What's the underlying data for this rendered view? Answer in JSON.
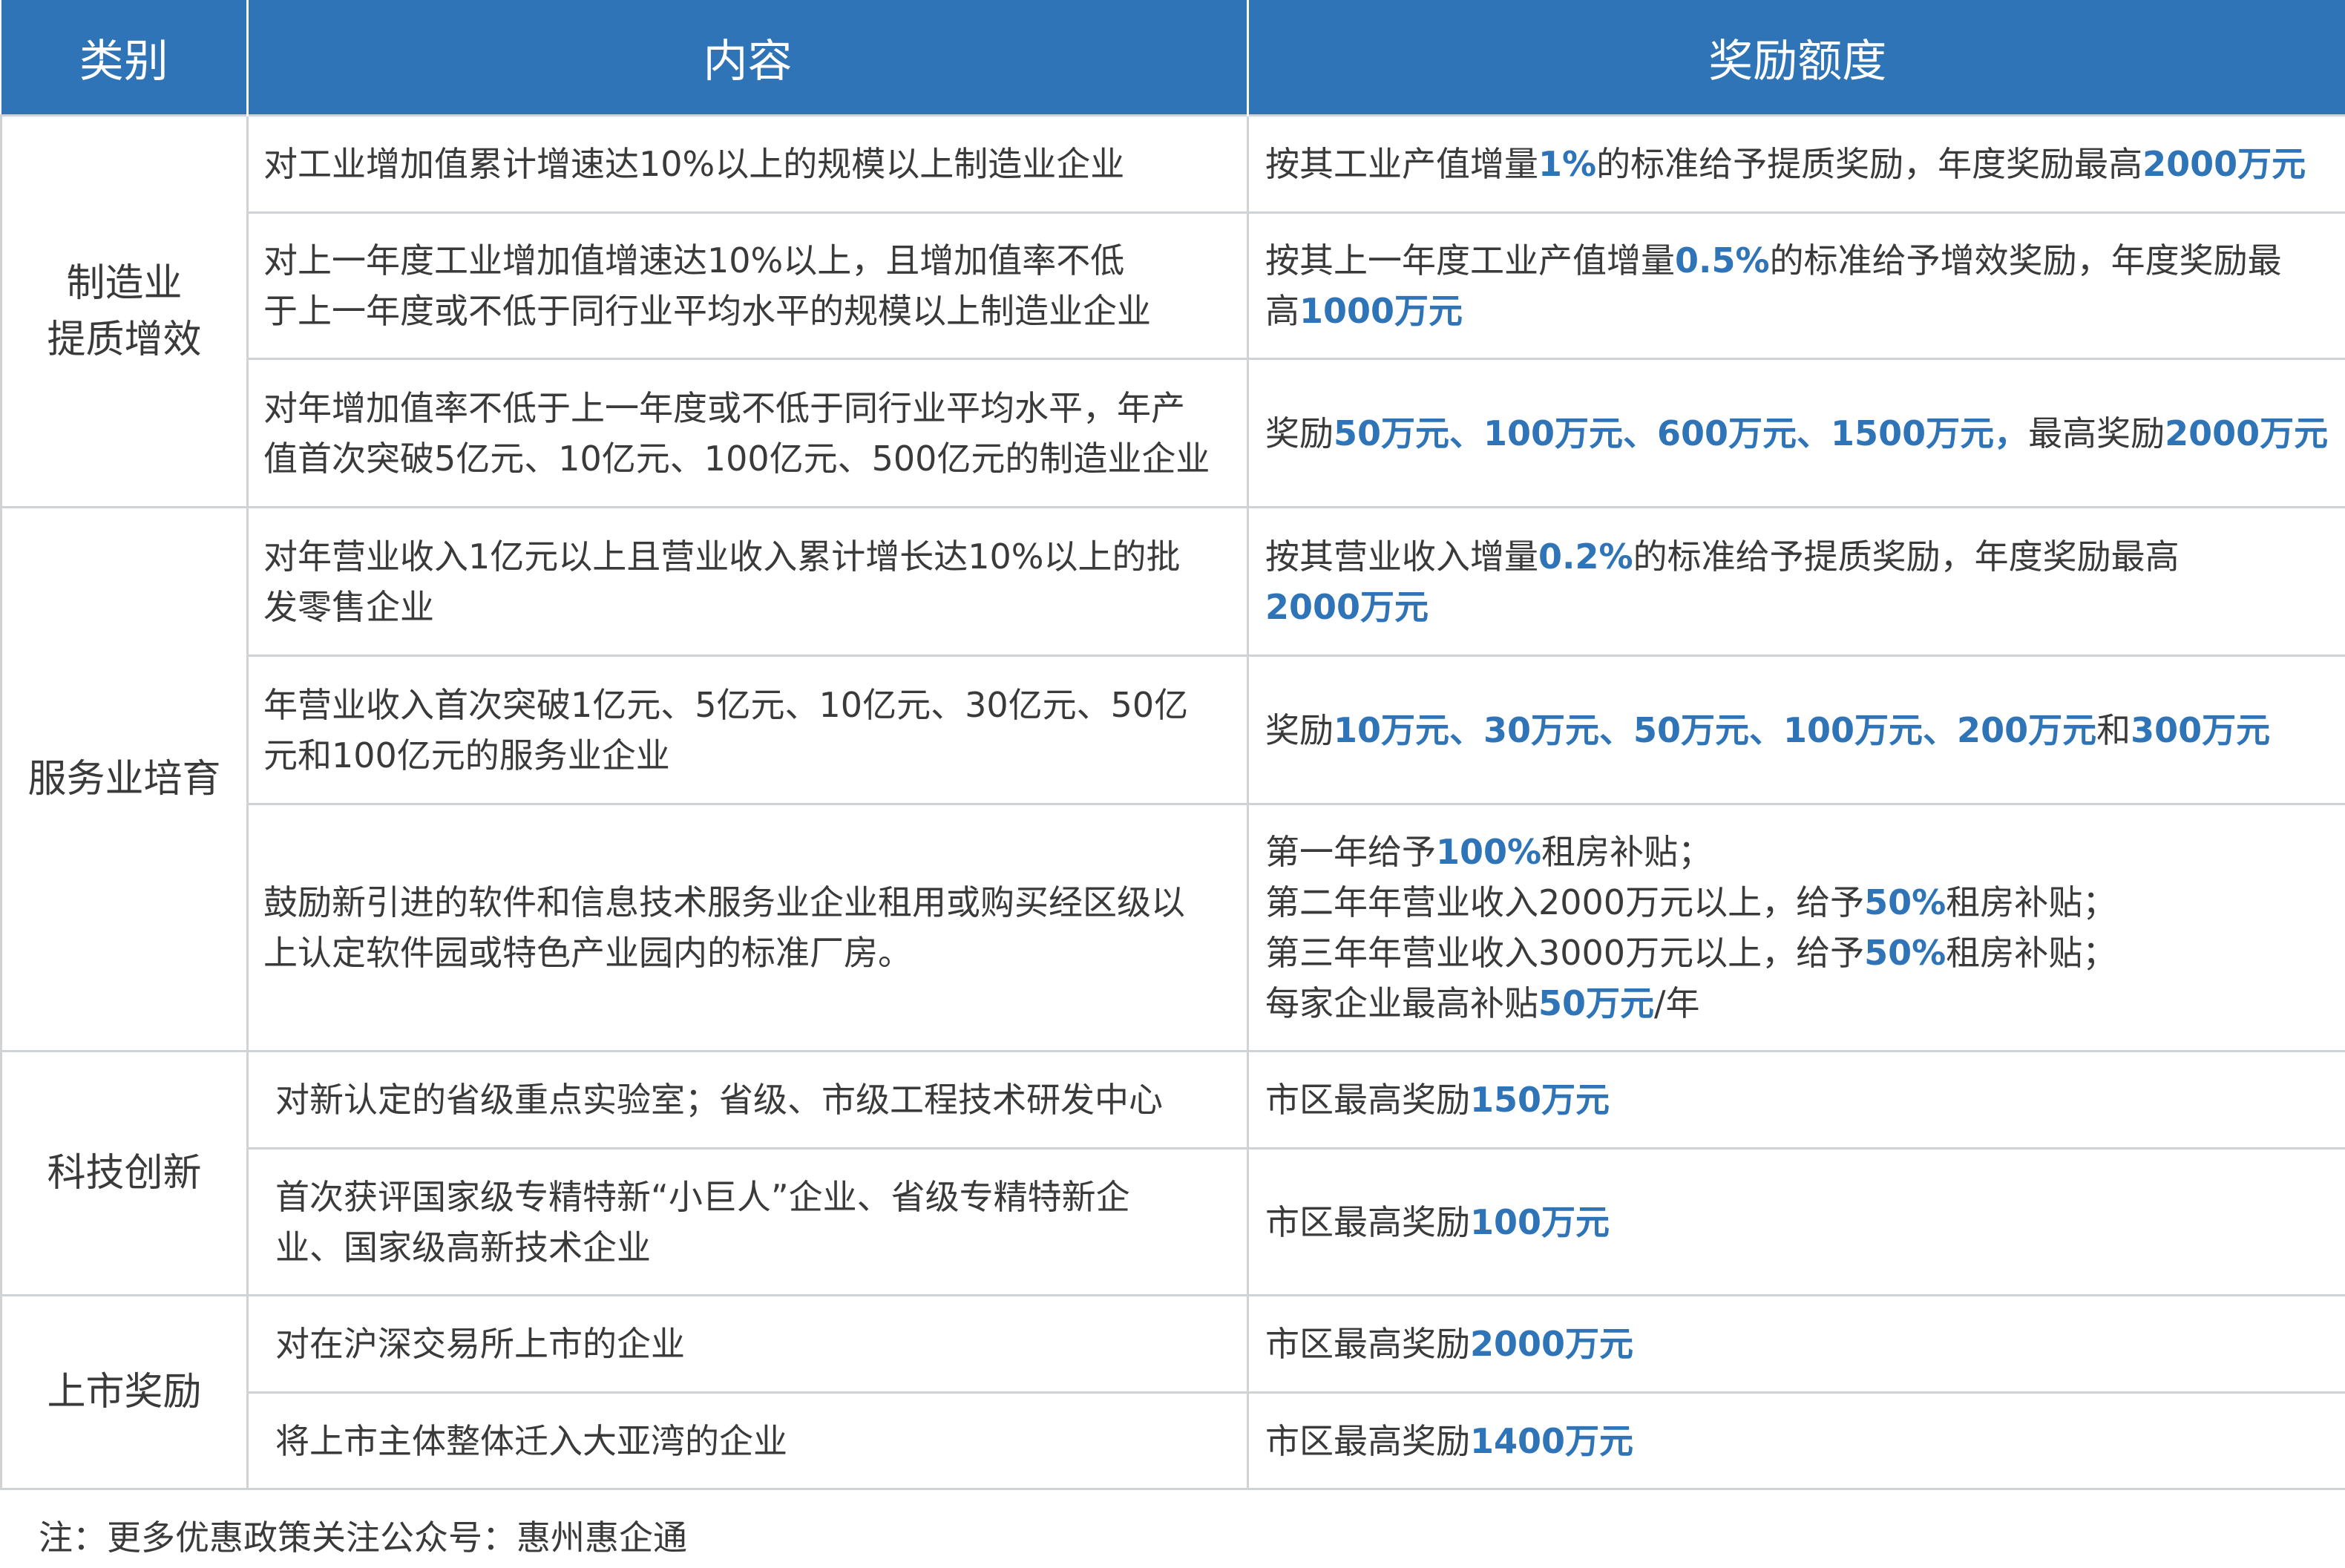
{
  "header": {
    "col_category": "类别",
    "col_content": "内容",
    "col_reward": "奖励额度"
  },
  "groups": [
    {
      "category": [
        "制造业",
        "提质增效"
      ],
      "rows": [
        {
          "content": [
            "对工业增加值累计增速达10%以上的规模以上制造业企业"
          ],
          "reward": [
            [
              [
                "按其工业产值增量",
                false
              ],
              [
                "1%",
                true
              ],
              [
                "的标准给予提质奖励，年度奖励最高",
                false
              ],
              [
                "2000万元",
                true
              ]
            ]
          ]
        },
        {
          "content": [
            "对上一年度工业增加值增速达10%以上，且增加值率不低",
            "于上一年度或不低于同行业平均水平的规模以上制造业企业"
          ],
          "reward": [
            [
              [
                "按其上一年度工业产值增量",
                false
              ],
              [
                "0.5%",
                true
              ],
              [
                "的标准给予增效奖励，年度奖励最",
                false
              ]
            ],
            [
              [
                "高",
                false
              ],
              [
                "1000万元",
                true
              ]
            ]
          ]
        },
        {
          "content": [
            "对年增加值率不低于上一年度或不低于同行业平均水平，年产",
            "值首次突破5亿元、10亿元、100亿元、500亿元的制造业企业"
          ],
          "reward": [
            [
              [
                "奖励",
                false
              ],
              [
                "50万元、100万元、600万元、1500万元，",
                true
              ],
              [
                "最高奖励",
                false
              ],
              [
                "2000万元",
                true
              ]
            ]
          ]
        }
      ]
    },
    {
      "category": [
        "服务业培育"
      ],
      "rows": [
        {
          "content": [
            "对年营业收入1亿元以上且营业收入累计增长达10%以上的批",
            "发零售企业"
          ],
          "reward": [
            [
              [
                "按其营业收入增量",
                false
              ],
              [
                "0.2%",
                true
              ],
              [
                "的标准给予提质奖励，年度奖励最高",
                false
              ]
            ],
            [
              [
                "2000万元",
                true
              ]
            ]
          ]
        },
        {
          "content": [
            "年营业收入首次突破1亿元、5亿元、10亿元、30亿元、50亿",
            "元和100亿元的服务业企业"
          ],
          "reward": [
            [
              [
                "奖励",
                false
              ],
              [
                "10万元、30万元、50万元、100万元、200万元",
                true
              ],
              [
                "和",
                false
              ],
              [
                "300万元",
                true
              ]
            ]
          ]
        },
        {
          "content": [
            "鼓励新引进的软件和信息技术服务业企业租用或购买经区级以",
            "上认定软件园或特色产业园内的标准厂房。"
          ],
          "reward": [
            [
              [
                "第一年给予",
                false
              ],
              [
                "100%",
                true
              ],
              [
                "租房补贴；",
                false
              ]
            ],
            [
              [
                "第二年年营业收入2000万元以上，给予",
                false
              ],
              [
                "50%",
                true
              ],
              [
                "租房补贴；",
                false
              ]
            ],
            [
              [
                "第三年年营业收入3000万元以上，给予",
                false
              ],
              [
                "50%",
                true
              ],
              [
                "租房补贴；",
                false
              ]
            ],
            [
              [
                "每家企业最高补贴",
                false
              ],
              [
                "50万元",
                true
              ],
              [
                "/年",
                false
              ]
            ]
          ]
        }
      ]
    },
    {
      "category": [
        "科技创新"
      ],
      "indent": true,
      "rows": [
        {
          "content": [
            "对新认定的省级重点实验室；省级、市级工程技术研发中心"
          ],
          "reward": [
            [
              [
                "市区最高奖励",
                false
              ],
              [
                "150万元",
                true
              ]
            ]
          ]
        },
        {
          "content": [
            "首次获评国家级专精特新“小巨人”企业、省级专精特新企",
            "业、国家级高新技术企业"
          ],
          "reward": [
            [
              [
                "市区最高奖励",
                false
              ],
              [
                "100万元",
                true
              ]
            ]
          ]
        }
      ]
    },
    {
      "category": [
        "上市奖励"
      ],
      "indent": true,
      "rows": [
        {
          "content": [
            "对在沪深交易所上市的企业"
          ],
          "reward": [
            [
              [
                "市区最高奖励",
                false
              ],
              [
                "2000万元",
                true
              ]
            ]
          ]
        },
        {
          "content": [
            "将上市主体整体迁入大亚湾的企业"
          ],
          "reward": [
            [
              [
                "市区最高奖励",
                false
              ],
              [
                "1400万元",
                true
              ]
            ]
          ]
        }
      ]
    }
  ],
  "note": "注：更多优惠政策关注公众号：惠州惠企通",
  "colors": {
    "header_bg": "#2f74b6",
    "highlight": "#2f74b6",
    "border": "#cfd3d6",
    "text": "#3a3a3a"
  }
}
